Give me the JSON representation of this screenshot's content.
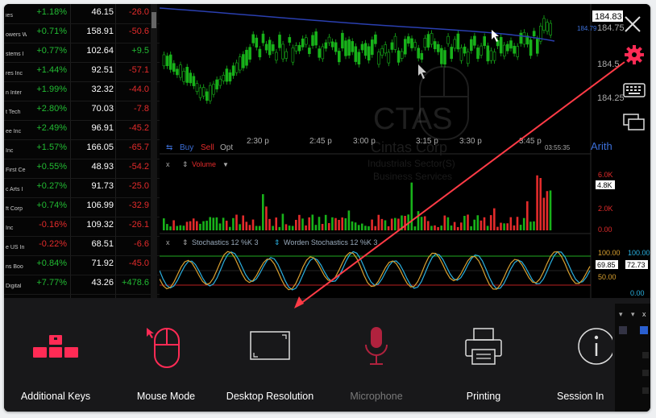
{
  "watchlist": {
    "rows": [
      {
        "name": "ies",
        "chg": "+1.18%",
        "last": "46.15",
        "net": "-26.0",
        "chg_color": "#22bb33",
        "net_color": "#e32b2b"
      },
      {
        "name": "owers W",
        "chg": "+0.71%",
        "last": "158.91",
        "net": "-50.6",
        "chg_color": "#22bb33",
        "net_color": "#e32b2b"
      },
      {
        "name": "stems I",
        "chg": "+0.77%",
        "last": "102.64",
        "net": "+9.5",
        "chg_color": "#22bb33",
        "net_color": "#22bb33"
      },
      {
        "name": "res Inc",
        "chg": "+1.44%",
        "last": "92.51",
        "net": "-57.1",
        "chg_color": "#22bb33",
        "net_color": "#e32b2b"
      },
      {
        "name": "n Inter",
        "chg": "+1.99%",
        "last": "32.32",
        "net": "-44.0",
        "chg_color": "#22bb33",
        "net_color": "#e32b2b"
      },
      {
        "name": "t Tech",
        "chg": "+2.80%",
        "last": "70.03",
        "net": "-7.8",
        "chg_color": "#22bb33",
        "net_color": "#e32b2b"
      },
      {
        "name": "ee Inc",
        "chg": "+2.49%",
        "last": "96.91",
        "net": "-45.2",
        "chg_color": "#22bb33",
        "net_color": "#e32b2b"
      },
      {
        "name": "Inc",
        "chg": "+1.57%",
        "last": "166.05",
        "net": "-65.7",
        "chg_color": "#22bb33",
        "net_color": "#e32b2b"
      },
      {
        "name": "First Ce",
        "chg": "+0.55%",
        "last": "48.93",
        "net": "-54.2",
        "chg_color": "#22bb33",
        "net_color": "#e32b2b"
      },
      {
        "name": "c Arts I",
        "chg": "+0.27%",
        "last": "91.73",
        "net": "-25.0",
        "chg_color": "#22bb33",
        "net_color": "#e32b2b"
      },
      {
        "name": "ft Corp",
        "chg": "+0.74%",
        "last": "106.99",
        "net": "-32.9",
        "chg_color": "#22bb33",
        "net_color": "#e32b2b"
      },
      {
        "name": "Inc",
        "chg": "-0.16%",
        "last": "109.32",
        "net": "-26.1",
        "chg_color": "#e32b2b",
        "net_color": "#e32b2b"
      },
      {
        "name": "e US In",
        "chg": "-0.22%",
        "last": "68.51",
        "net": "-6.6",
        "chg_color": "#e32b2b",
        "net_color": "#e32b2b"
      },
      {
        "name": "ns Boo",
        "chg": "+0.84%",
        "last": "71.92",
        "net": "-45.0",
        "chg_color": "#22bb33",
        "net_color": "#e32b2b"
      },
      {
        "name": "Digital",
        "chg": "+7.77%",
        "last": "43.26",
        "net": "+478.6",
        "chg_color": "#22bb33",
        "net_color": "#22bb33"
      }
    ]
  },
  "chart": {
    "symbol": "CTAS",
    "company": "Cintas Corp",
    "sector": "Industrials Sector(S)",
    "industry": "Business Services",
    "price_labels": [
      "184.83",
      "184.75",
      "184.5",
      "184.25"
    ],
    "price_small": "184.79",
    "time_labels": [
      "2:30 p",
      "2:45 p",
      "3:00 p",
      "3:15 p",
      "3:30 p",
      "3:45 p"
    ],
    "clock": "03:55:35",
    "scale_mode": "Arith",
    "toolbar": {
      "buy": "Buy",
      "sell": "Sell",
      "opt": "Opt"
    },
    "volume": {
      "title": "Volume",
      "labels": [
        "6.0K",
        "4.8K",
        "2.0K",
        "0.00"
      ]
    },
    "stochastics": {
      "title": "Stochastics 12 %K 3",
      "title2": "Worden Stochastics 12 %K 3",
      "labels": [
        "100.00",
        "69.85",
        "72.73",
        "50.00",
        "0.00"
      ]
    },
    "colors": {
      "up": "#18b21a",
      "down": "#e32b2b",
      "signal": "#ff2b55"
    }
  },
  "sidebar": {
    "icons": [
      "gear-icon",
      "keyboard-icon",
      "display-icon"
    ]
  },
  "panel": {
    "items": [
      {
        "label": "Additional Keys"
      },
      {
        "label": "Mouse Mode"
      },
      {
        "label": "Desktop Resolution"
      },
      {
        "label": "Microphone"
      },
      {
        "label": "Printing"
      },
      {
        "label": "Session In"
      }
    ]
  }
}
